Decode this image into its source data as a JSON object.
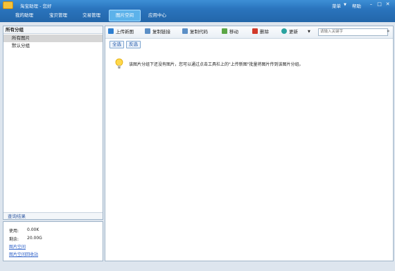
{
  "window": {
    "title": "淘宝助理 - 您好",
    "menu_label": "菜单",
    "help_label": "帮助"
  },
  "nav": {
    "tabs": [
      {
        "label": "我的助理"
      },
      {
        "label": "宝贝管理"
      },
      {
        "label": "交易管理"
      },
      {
        "label": "图片空间"
      },
      {
        "label": "应用中心"
      }
    ],
    "active_tab": "图片空间"
  },
  "sidebar": {
    "header": "所有分组",
    "items": [
      {
        "label": "所有图片"
      },
      {
        "label": "默认分组"
      }
    ],
    "selected": "所有图片",
    "query_label": "查询结果"
  },
  "usage": {
    "used_label": "使用:",
    "used_value": "0.00K",
    "remain_label": "剩余:",
    "remain_value": "20.00G",
    "link_space": "图片空间",
    "link_recycle": "图片空间回收站"
  },
  "toolbar": {
    "upload": "上传新图",
    "copy_link": "复制链接",
    "copy_code": "复制代码",
    "move": "移动",
    "delete": "删除",
    "refresh": "更新",
    "search_placeholder": "请输入关键字"
  },
  "selection": {
    "select_all": "全选",
    "invert": "反选"
  },
  "empty_message": "该图片分组下还没有图片，您可以通过点击工具栏上的\"上传新图\"批量将图片传到该图片分组。",
  "colors": {
    "titlebar": "#3d8fd6",
    "active_tab": "#5cb2ea",
    "link": "#2b5ec7"
  }
}
